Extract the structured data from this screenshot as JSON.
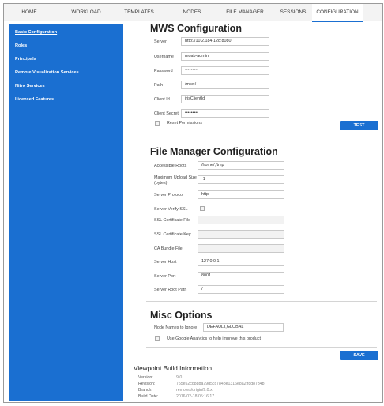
{
  "nav": {
    "tabs": [
      {
        "label": "HOME"
      },
      {
        "label": "WORKLOAD"
      },
      {
        "label": "TEMPLATES"
      },
      {
        "label": "NODES"
      },
      {
        "label": "FILE MANAGER"
      },
      {
        "label": "SESSIONS"
      },
      {
        "label": "CONFIGURATION"
      }
    ]
  },
  "sidebar": {
    "items": [
      {
        "label": "Basic Configuration"
      },
      {
        "label": "Roles"
      },
      {
        "label": "Principals"
      },
      {
        "label": "Remote Visualization Services"
      },
      {
        "label": "Nitro Services"
      },
      {
        "label": "Licensed Features"
      }
    ]
  },
  "mws": {
    "title": "MWS Configuration",
    "server_label": "Server",
    "server_value": "http://10.2.184.128:8080",
    "username_label": "Username",
    "username_value": "moab-admin",
    "password_label": "Password",
    "password_value": "•••••••••",
    "path_label": "Path",
    "path_value": "/mws/",
    "client_id_label": "Client Id",
    "client_id_value": "irisClientId",
    "client_secret_label": "Client Secret",
    "client_secret_value": "•••••••••",
    "reset_label": "Reset Permissions",
    "test_label": "TEST"
  },
  "fm": {
    "title": "File Manager Configuration",
    "roots_label": "Accessible Roots",
    "roots_value": "/home/;/tmp",
    "upload_label_1": "Maximum Upload Size",
    "upload_label_2": "(bytes)",
    "upload_value": "-1",
    "protocol_label": "Server Protocol",
    "protocol_value": "http",
    "verify_label": "Server Verify SSL",
    "cert_label": "SSL Certificate File",
    "cert_value": "",
    "key_label": "SSL Certificate Key",
    "key_value": "",
    "ca_label": "CA Bundle File",
    "ca_value": "",
    "host_label": "Server Host",
    "host_value": "127.0.0.1",
    "port_label": "Server Port",
    "port_value": "8001",
    "rootpath_label": "Server Root Path",
    "rootpath_value": "/"
  },
  "misc": {
    "title": "Misc Options",
    "ignore_label": "Node Names to Ignore",
    "ignore_value": "DEFAULT,GLOBAL",
    "analytics_label": "Use Google Analytics to help improve this product",
    "save_label": "SAVE"
  },
  "build": {
    "title": "Viewpoint Build Information",
    "version_label": "Version:",
    "version_value": "9.0",
    "revision_label": "Revision:",
    "revision_value": "755e52cd88ba79d5cc784be1316e8a2ff8d8734b",
    "branch_label": "Branch:",
    "branch_value": "remotes/origin/9.0.x",
    "date_label": "Build Date:",
    "date_value": "2016-02-18 05:16:17"
  },
  "colors": {
    "accent": "#1a6fd1",
    "sidebar": "#1a6fd1"
  }
}
